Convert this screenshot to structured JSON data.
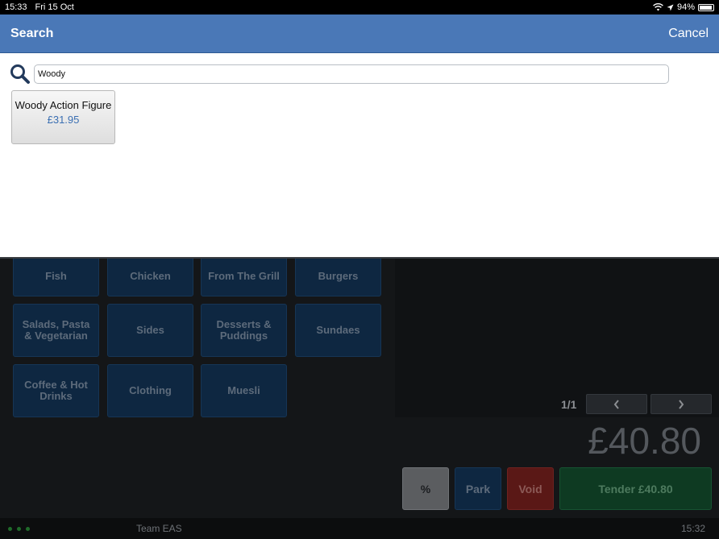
{
  "status_bar": {
    "time": "15:33",
    "date": "Fri 15 Oct",
    "battery": "94%"
  },
  "search": {
    "title": "Search",
    "cancel_label": "Cancel",
    "query": "Woody"
  },
  "results": [
    {
      "name": "Woody Action Figure",
      "price": "£31.95"
    }
  ],
  "categories": [
    "Fish",
    "Chicken",
    "From The Grill",
    "Burgers",
    "Salads, Pasta & Vegetarian",
    "Sides",
    "Desserts & Puddings",
    "Sundaes",
    "Coffee & Hot Drinks",
    "Clothing",
    "Muesli"
  ],
  "order": {
    "page": "1/1",
    "total": "£40.80",
    "discount_label": "%",
    "park_label": "Park",
    "void_label": "Void",
    "tender_label": "Tender £40.80"
  },
  "footer": {
    "team": "Team EAS",
    "time": "15:32"
  },
  "colors": {
    "header": "#4a78b7",
    "category": "#0e2741",
    "void": "#5a1816",
    "tender": "#0e3a22"
  }
}
